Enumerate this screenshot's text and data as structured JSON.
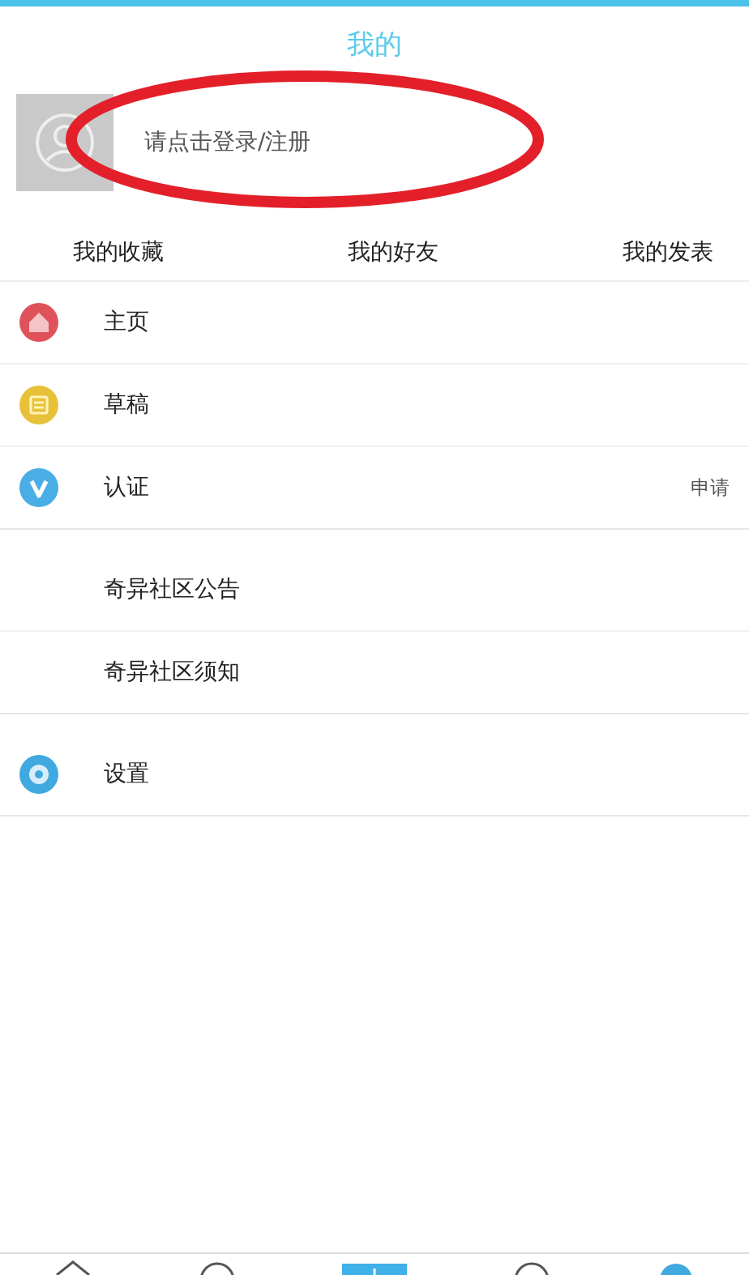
{
  "title": "我的",
  "profile": {
    "login_prompt": "请点击登录/注册",
    "highlighted": true
  },
  "tabs": [
    {
      "label": "我的收藏"
    },
    {
      "label": "我的好友"
    },
    {
      "label": "我的发表"
    }
  ],
  "menu_groups": [
    [
      {
        "label": "主页",
        "kind": "home"
      },
      {
        "label": "草稿",
        "kind": "draft"
      },
      {
        "label": "认证",
        "kind": "verify",
        "value": "申请"
      }
    ],
    [
      {
        "label": "奇异社区公告"
      },
      {
        "label": "奇异社区须知"
      }
    ],
    [
      {
        "label": "设置",
        "kind": "settings"
      }
    ]
  ],
  "bottom_nav": [
    {
      "kind": "home"
    },
    {
      "kind": "circle"
    },
    {
      "kind": "add"
    },
    {
      "kind": "circle"
    },
    {
      "kind": "dot"
    }
  ]
}
